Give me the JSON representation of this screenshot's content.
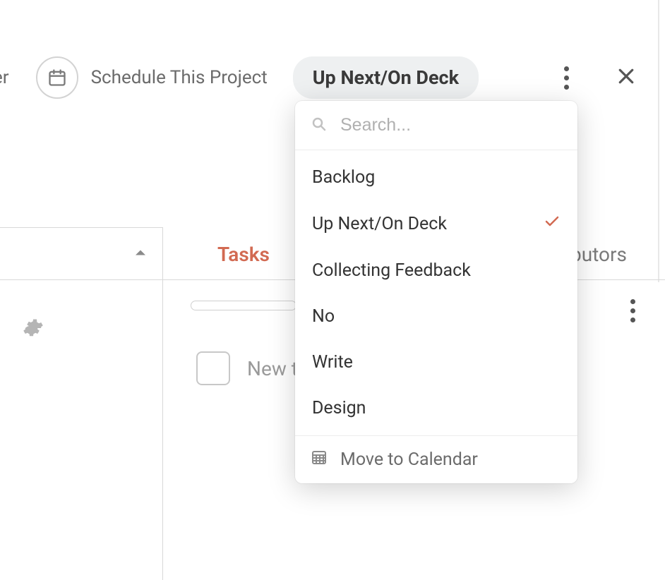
{
  "toolbar": {
    "left_partial": "er",
    "schedule_label": "Schedule This Project",
    "status_pill": "Up Next/On Deck"
  },
  "tabs": {
    "tasks": "Tasks",
    "contributors_partial": "butors"
  },
  "task": {
    "new_placeholder": "New t"
  },
  "dropdown": {
    "search_placeholder": "Search...",
    "items": [
      {
        "label": "Backlog",
        "selected": false
      },
      {
        "label": "Up Next/On Deck",
        "selected": true
      },
      {
        "label": "Collecting Feedback",
        "selected": false
      },
      {
        "label": "No",
        "selected": false
      },
      {
        "label": "Write",
        "selected": false
      },
      {
        "label": "Design",
        "selected": false
      }
    ],
    "footer_label": "Move to Calendar"
  }
}
